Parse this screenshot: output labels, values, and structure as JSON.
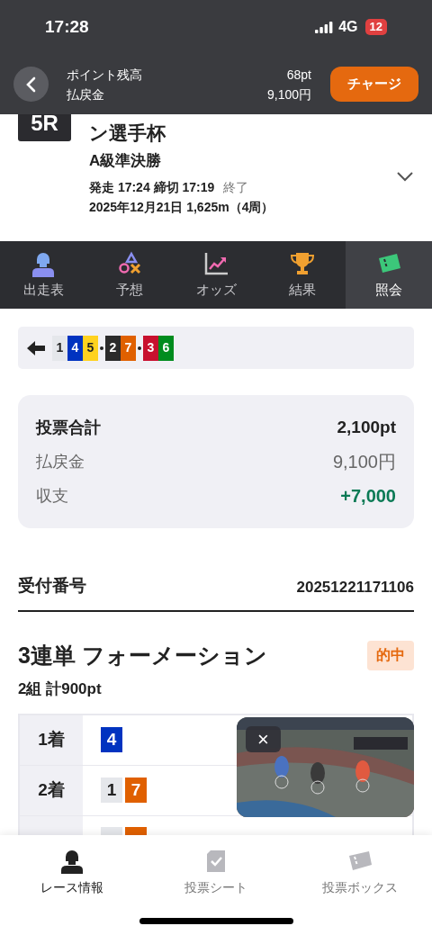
{
  "status_bar": {
    "time": "17:28",
    "network": "4G",
    "battery": "12"
  },
  "header": {
    "balance_label": "ポイント残高",
    "balance": "68pt",
    "payout_label": "払戻金",
    "payout": "9,100円",
    "charge_button": "チャージ"
  },
  "race": {
    "number": "5R",
    "title": "ン選手杯",
    "grade": "A級準決勝",
    "schedule": "発走 17:24 締切 17:19",
    "status": "終了",
    "date": "2025年12月21日 1,625m（4周）"
  },
  "tabs": [
    {
      "label": "出走表",
      "kind": "entries",
      "selected": false
    },
    {
      "label": "予想",
      "kind": "forecast",
      "selected": false
    },
    {
      "label": "オッズ",
      "kind": "odds",
      "selected": false
    },
    {
      "label": "結果",
      "kind": "result",
      "selected": false
    },
    {
      "label": "照会",
      "kind": "ticket",
      "selected": true
    }
  ],
  "combination": [
    [
      {
        "number": "1",
        "color": "#e5e7eb"
      },
      {
        "number": "4",
        "color": "#0033c0"
      },
      {
        "number": "5",
        "color": "#ffd21f"
      }
    ],
    [
      {
        "number": "2",
        "color": "#2b2b2b"
      },
      {
        "number": "7",
        "color": "#e06000"
      }
    ],
    [
      {
        "number": "3",
        "color": "#c8102e"
      },
      {
        "number": "6",
        "color": "#008c1e"
      }
    ]
  ],
  "summary": [
    {
      "label": "投票合計",
      "value": "2,100pt",
      "kind": "total"
    },
    {
      "label": "払戻金",
      "value": "9,100円",
      "kind": "payout"
    },
    {
      "label": "収支",
      "value": "+7,000",
      "kind": "balance"
    }
  ],
  "receipt": {
    "label": "受付番号",
    "value": "20251221171106"
  },
  "bet": {
    "title": "3連単 フォーメーション",
    "result": "的中",
    "subtitle": "2組 計900pt",
    "rows": [
      {
        "label": "1着",
        "numbers": [
          {
            "number": "4",
            "color": "#0033c0"
          }
        ]
      },
      {
        "label": "2着",
        "numbers": [
          {
            "number": "1",
            "color": "#e5e7eb"
          },
          {
            "number": "7",
            "color": "#e06000"
          }
        ]
      }
    ],
    "partial_row": {
      "tiles": [
        {
          "color": "#e5e7eb"
        },
        {
          "color": "#e06000"
        }
      ]
    }
  },
  "video": {
    "kind": "picture",
    "close": "×"
  },
  "bottom_nav": [
    {
      "label": "レース情報",
      "kind": "race",
      "selected": true
    },
    {
      "label": "投票シート",
      "kind": "sheet",
      "selected": false
    },
    {
      "label": "投票ボックス",
      "kind": "box",
      "selected": false
    }
  ]
}
